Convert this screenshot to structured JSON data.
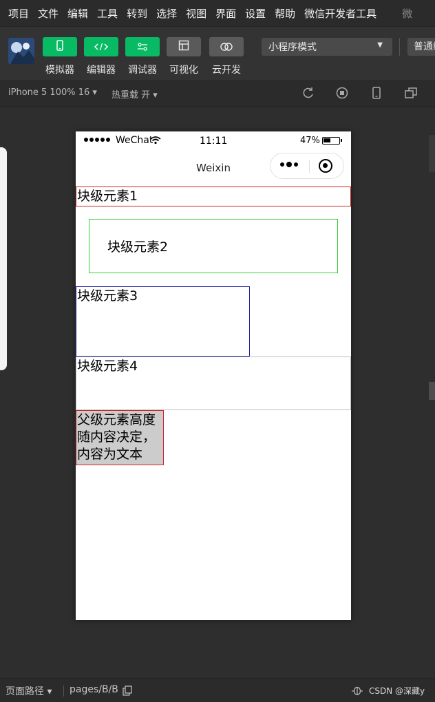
{
  "menu": {
    "items": [
      "项目",
      "文件",
      "编辑",
      "工具",
      "转到",
      "选择",
      "视图",
      "界面",
      "设置",
      "帮助",
      "微信开发者工具"
    ],
    "title_cut": "微"
  },
  "toolbar": {
    "buttons": [
      {
        "label": "模拟器",
        "icon": "phone-icon"
      },
      {
        "label": "编辑器",
        "icon": "code-icon"
      },
      {
        "label": "调试器",
        "icon": "debug-icon"
      },
      {
        "label": "可视化",
        "icon": "layout-icon"
      },
      {
        "label": "云开发",
        "icon": "cloud-icon"
      }
    ],
    "mode_select": "小程序模式",
    "compile_select": "普通编"
  },
  "device_bar": {
    "device": "iPhone 5 100% 16 ▾",
    "hot_reload": "热重载 开 ▾"
  },
  "phone": {
    "status": {
      "carrier": "WeChat",
      "time": "11:11",
      "battery": "47%"
    },
    "nav_title": "Weixin",
    "blocks": {
      "b1": "块级元素1",
      "b2": "块级元素2",
      "b3": "块级元素3",
      "b4": "块级元素4",
      "b5": "父级元素高度随内容决定，内容为文本"
    }
  },
  "bottom_bar": {
    "route_label": "页面路径 ▾",
    "path": "pages/B/B",
    "watermark": "CSDN @深藏y"
  }
}
